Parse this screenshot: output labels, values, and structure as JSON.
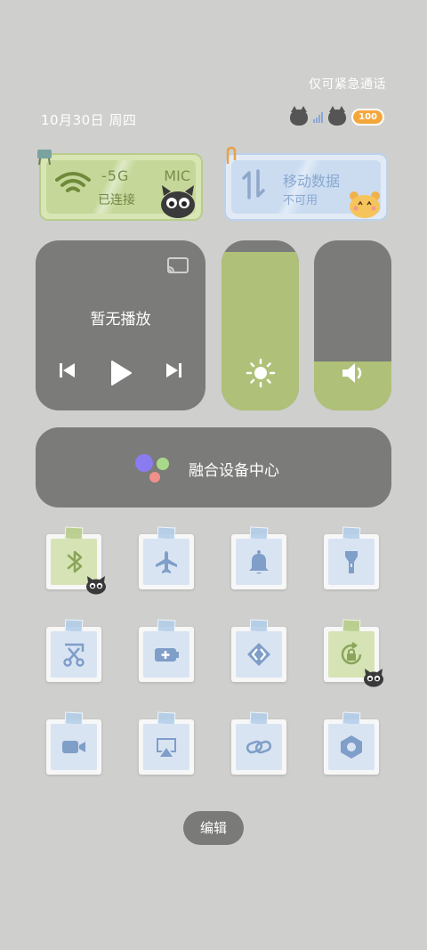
{
  "status_bar": {
    "emergency_text": "仅可紧急通话",
    "date_text": "10月30日 周四",
    "battery_badge": "100"
  },
  "wifi_card": {
    "ssid": "-5G",
    "ssid_suffix": "MIC",
    "status": "已连接",
    "icon": "wifi-icon"
  },
  "data_card": {
    "title": "移动数据",
    "status": "不可用",
    "icon": "data-arrows-icon"
  },
  "media": {
    "title": "暂无播放",
    "prev_icon": "skip-previous-icon",
    "play_icon": "play-icon",
    "next_icon": "skip-next-icon",
    "cast_icon": "cast-icon"
  },
  "brightness": {
    "level": 0.93,
    "icon": "sun-icon"
  },
  "volume": {
    "level": 0.29,
    "icon": "speaker-icon"
  },
  "device_hub": {
    "label": "融合设备中心",
    "icon": "device-hub-dots-icon"
  },
  "tiles": [
    {
      "name": "bluetooth",
      "icon": "bluetooth-icon",
      "active": true
    },
    {
      "name": "airplane-mode",
      "icon": "airplane-icon",
      "active": false
    },
    {
      "name": "ring-mode",
      "icon": "bell-icon",
      "active": false
    },
    {
      "name": "flashlight",
      "icon": "flashlight-icon",
      "active": false
    },
    {
      "name": "screenshot",
      "icon": "scissors-icon",
      "active": false
    },
    {
      "name": "battery-saver",
      "icon": "battery-plus-icon",
      "active": false
    },
    {
      "name": "vpn",
      "icon": "chevron-code-icon",
      "active": false
    },
    {
      "name": "rotation-lock",
      "icon": "rotation-lock-icon",
      "active": true
    },
    {
      "name": "screen-record",
      "icon": "video-camera-icon",
      "active": false
    },
    {
      "name": "screen-cast",
      "icon": "airplay-icon",
      "active": false
    },
    {
      "name": "link",
      "icon": "link-icon",
      "active": false
    },
    {
      "name": "settings",
      "icon": "hexagon-gear-icon",
      "active": false
    }
  ],
  "edit_button": "编辑",
  "colors": {
    "background": "#cfcfcd",
    "panel": "#7b7b79",
    "accent_green": "#afc178",
    "tile_blue": "#7f9ec8"
  }
}
